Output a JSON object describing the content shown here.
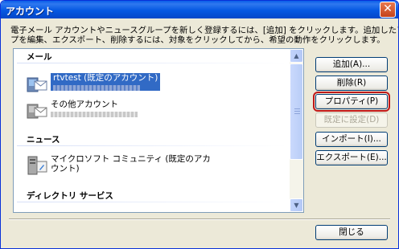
{
  "window": {
    "title": "アカウント",
    "close_glyph": "✕"
  },
  "instruction": {
    "line1": "電子メール アカウントやニュースグループを新しく登録するには、[追加] をクリックします。追加したアカウントやニュースグルー",
    "line2": "プを編集、エクスポート、削除するには、対象をクリックしてから、希望の動作をクリックします。"
  },
  "groups": {
    "mail": "メール",
    "news": "ニュース",
    "directory": "ディレクトリ サービス"
  },
  "accounts": {
    "mail": [
      {
        "name": "rtvtest (既定のアカウント)",
        "selected": true
      },
      {
        "name": "その他アカウント",
        "selected": false
      }
    ],
    "news": [
      {
        "name_line1": "マイクロソフト コミュニティ (既定のアカ",
        "name_line2": "ウント)"
      }
    ]
  },
  "buttons": {
    "add": "追加(A)...",
    "delete": "削除(R)",
    "properties": "プロパティ(P)",
    "set_default": "既定に設定(D)",
    "import": "インポート(I)...",
    "export": "エクスポート(E)...",
    "close": "閉じる"
  },
  "colors": {
    "titlebar": "#0558e2",
    "selection": "#316ac5",
    "focus_highlight": "#c01818"
  }
}
